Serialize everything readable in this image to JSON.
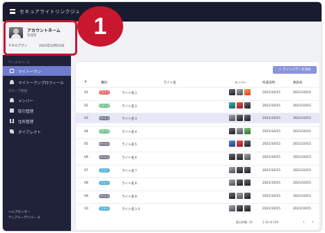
{
  "app": {
    "title": "セキュアライトリンクジュ"
  },
  "step": {
    "number": "1",
    "color": "#c8172f"
  },
  "profile": {
    "name": "アカウントネーム",
    "role": "管理者",
    "plan": "ＰＲＯプラン",
    "date": "2021年10月15日"
  },
  "sidebar": {
    "section1": "ワークスペース",
    "items1": [
      {
        "label": "マイトークン",
        "icon": "chat-icon",
        "active": true
      },
      {
        "label": "マイトークンプロフィール",
        "icon": "user-icon",
        "active": false
      }
    ],
    "section2": "グループ管理",
    "items2": [
      {
        "label": "メンバー",
        "icon": "people-icon"
      },
      {
        "label": "取引管理",
        "icon": "document-icon"
      },
      {
        "label": "住所管理",
        "icon": "book-icon"
      },
      {
        "label": "ダイアレクト",
        "icon": "phone-icon"
      }
    ],
    "footer": [
      "ヘルプセンター",
      "ティアルーデリバー ©"
    ]
  },
  "toolbar": {
    "add_label": "＋ ライトパディを追加"
  },
  "table": {
    "headers": {
      "no": "#",
      "status": "種別",
      "name": "ライト名",
      "members": "メンバー",
      "created": "作成日時",
      "updated": "更新日"
    },
    "rows": [
      {
        "no": "01",
        "status": "アクティブ",
        "status_color": "#e86b6b",
        "name": "ライト名１",
        "members": [
          "m-dark",
          "m-gray",
          "m-warm"
        ],
        "created": "2021/10/15",
        "updated": "2021/10/15",
        "selected": false
      },
      {
        "no": "02",
        "status": "スタンダード",
        "status_color": "#6cc58a",
        "name": "ライト名２",
        "members": [
          "m-teal",
          "m-red",
          "m-dark"
        ],
        "created": "2021/10/15",
        "updated": "2021/10/15",
        "selected": false
      },
      {
        "no": "03",
        "status": "ベーシック",
        "status_color": "#7f8491",
        "name": "ライト名３",
        "members": [
          "m-gray",
          "m-dark",
          "m-dark"
        ],
        "created": "2021/10/15",
        "updated": "2021/10/15",
        "selected": true
      },
      {
        "no": "04",
        "status": "スタンダード",
        "status_color": "#6cc58a",
        "name": "ライト名４",
        "members": [
          "m-dark",
          "m-gray",
          "m-green"
        ],
        "created": "2021/10/15",
        "updated": "2021/10/15",
        "selected": false
      },
      {
        "no": "05",
        "status": "ベーシック",
        "status_color": "#7f8491",
        "name": "ライト名５",
        "members": [
          "m-blue",
          "m-red",
          "m-dark"
        ],
        "created": "2021/10/15",
        "updated": "2021/10/15",
        "selected": false
      },
      {
        "no": "06",
        "status": "ベーシック",
        "status_color": "#7f8491",
        "name": "ライト名６",
        "members": [
          "m-dark",
          "m-dark",
          "m-gray"
        ],
        "created": "2021/10/15",
        "updated": "2021/10/15",
        "selected": false
      },
      {
        "no": "07",
        "status": "フリー",
        "status_color": "#5fb7d6",
        "name": "ライト名７",
        "members": [
          "m-gray",
          "m-dark",
          "m-dark"
        ],
        "created": "2021/10/15",
        "updated": "2021/10/15",
        "selected": false
      },
      {
        "no": "08",
        "status": "フリー",
        "status_color": "#5fb7d6",
        "name": "ライト名８",
        "members": [
          "m-gray",
          "m-dark",
          "m-dark"
        ],
        "created": "2021/10/15",
        "updated": "2021/10/15",
        "selected": false
      },
      {
        "no": "09",
        "status": "ベーシック",
        "status_color": "#7f8491",
        "name": "ライト名９",
        "members": [
          "m-dark",
          "m-gray",
          "m-dark"
        ],
        "created": "2021/10/15",
        "updated": "2021/10/15",
        "selected": false
      },
      {
        "no": "10",
        "status": "フリー",
        "status_color": "#5fb7d6",
        "name": "ライト名１０",
        "members": [
          "m-gray",
          "m-dark",
          "m-dark"
        ],
        "created": "2021/10/15",
        "updated": "2021/10/15",
        "selected": false
      }
    ]
  },
  "pager": {
    "rows_label": "表示件数: 10",
    "range": "1-10 of 100"
  }
}
